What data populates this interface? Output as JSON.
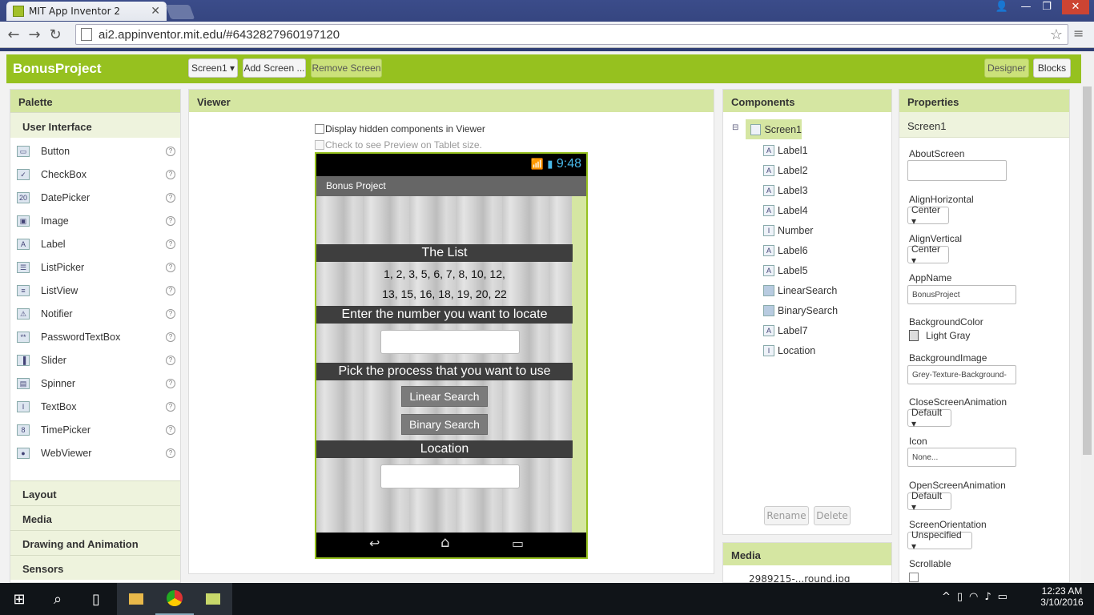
{
  "browser": {
    "tab_title": "MIT App Inventor 2",
    "url": "ai2.appinventor.mit.edu/#6432827960197120"
  },
  "header": {
    "project_name": "BonusProject",
    "screen_select": "Screen1 ▾",
    "add_screen": "Add Screen ...",
    "remove_screen": "Remove Screen",
    "designer": "Designer",
    "blocks": "Blocks",
    "accent_color": "#96c11f"
  },
  "palette": {
    "title": "Palette",
    "category": "User Interface",
    "items": [
      {
        "label": "Button",
        "icon": "button-icon"
      },
      {
        "label": "CheckBox",
        "icon": "checkbox-icon"
      },
      {
        "label": "DatePicker",
        "icon": "datepicker-icon"
      },
      {
        "label": "Image",
        "icon": "image-icon"
      },
      {
        "label": "Label",
        "icon": "label-icon"
      },
      {
        "label": "ListPicker",
        "icon": "listpicker-icon"
      },
      {
        "label": "ListView",
        "icon": "listview-icon"
      },
      {
        "label": "Notifier",
        "icon": "notifier-icon"
      },
      {
        "label": "PasswordTextBox",
        "icon": "password-icon"
      },
      {
        "label": "Slider",
        "icon": "slider-icon"
      },
      {
        "label": "Spinner",
        "icon": "spinner-icon"
      },
      {
        "label": "TextBox",
        "icon": "textbox-icon"
      },
      {
        "label": "TimePicker",
        "icon": "timepicker-icon"
      },
      {
        "label": "WebViewer",
        "icon": "webviewer-icon"
      }
    ],
    "sections": [
      "Layout",
      "Media",
      "Drawing and Animation",
      "Sensors"
    ]
  },
  "viewer": {
    "title": "Viewer",
    "hidden_check": "Display hidden components in Viewer",
    "tablet_check": "Check to see Preview on Tablet size.",
    "phone": {
      "time": "9:48",
      "app_title": "Bonus Project",
      "list_header": "The List",
      "list_line1": "1, 2, 3, 5, 6, 7, 8, 10, 12,",
      "list_line2": "13, 15, 16, 18, 19, 20, 22",
      "enter_label": "Enter the number you want to locate",
      "pick_label": "Pick the process that you want to use",
      "linear_button": "Linear Search",
      "binary_button": "Binary Search",
      "location_label": "Location"
    }
  },
  "components": {
    "title": "Components",
    "root": "Screen1",
    "children": [
      {
        "label": "Label1",
        "icon": "A"
      },
      {
        "label": "Label2",
        "icon": "A"
      },
      {
        "label": "Label3",
        "icon": "A"
      },
      {
        "label": "Label4",
        "icon": "A"
      },
      {
        "label": "Number",
        "icon": "I"
      },
      {
        "label": "Label6",
        "icon": "A"
      },
      {
        "label": "Label5",
        "icon": "A"
      },
      {
        "label": "LinearSearch",
        "icon": ""
      },
      {
        "label": "BinarySearch",
        "icon": ""
      },
      {
        "label": "Label7",
        "icon": "A"
      },
      {
        "label": "Location",
        "icon": "I"
      }
    ],
    "rename": "Rename",
    "delete": "Delete"
  },
  "media": {
    "title": "Media",
    "file": "2989215-...round.jpg"
  },
  "properties": {
    "title": "Properties",
    "component": "Screen1",
    "about_label": "AboutScreen",
    "about_value": "",
    "align_h_label": "AlignHorizontal",
    "align_h_value": "Center ▾",
    "align_v_label": "AlignVertical",
    "align_v_value": "Center ▾",
    "appname_label": "AppName",
    "appname_value": "BonusProject",
    "bgcolor_label": "BackgroundColor",
    "bgcolor_value": "Light Gray",
    "bgimage_label": "BackgroundImage",
    "bgimage_value": "Grey-Texture-Background-",
    "close_anim_label": "CloseScreenAnimation",
    "close_anim_value": "Default ▾",
    "icon_label": "Icon",
    "icon_value": "None...",
    "open_anim_label": "OpenScreenAnimation",
    "open_anim_value": "Default ▾",
    "orientation_label": "ScreenOrientation",
    "orientation_value": "Unspecified ▾",
    "scrollable_label": "Scrollable"
  },
  "taskbar": {
    "time": "12:23 AM",
    "date": "3/10/2016"
  }
}
